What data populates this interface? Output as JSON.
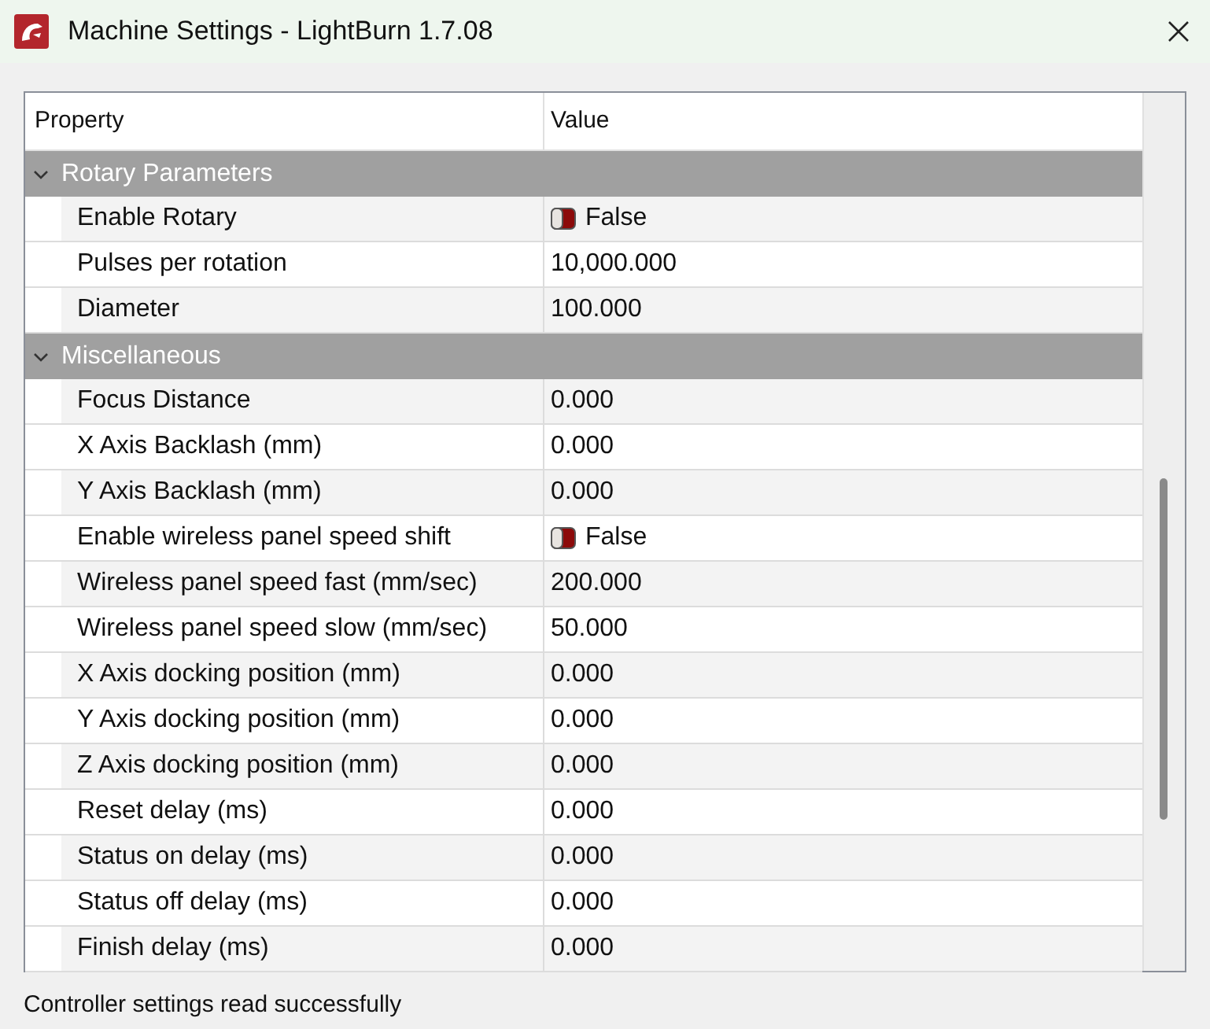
{
  "window": {
    "title": "Machine Settings - LightBurn 1.7.08"
  },
  "table": {
    "columns": [
      "Property",
      "Value"
    ],
    "groups": [
      {
        "name": "Rotary Parameters",
        "expanded": true,
        "rows": [
          {
            "property": "Enable Rotary",
            "value": "False",
            "kind": "toggle",
            "on": false
          },
          {
            "property": "Pulses per rotation",
            "value": "10,000.000",
            "kind": "number"
          },
          {
            "property": "Diameter",
            "value": "100.000",
            "kind": "number"
          }
        ]
      },
      {
        "name": "Miscellaneous",
        "expanded": true,
        "rows": [
          {
            "property": "Focus Distance",
            "value": "0.000",
            "kind": "number"
          },
          {
            "property": "X Axis Backlash (mm)",
            "value": "0.000",
            "kind": "number"
          },
          {
            "property": "Y Axis Backlash (mm)",
            "value": "0.000",
            "kind": "number"
          },
          {
            "property": "Enable wireless panel speed shift",
            "value": "False",
            "kind": "toggle",
            "on": false
          },
          {
            "property": "Wireless panel speed fast (mm/sec)",
            "value": "200.000",
            "kind": "number"
          },
          {
            "property": "Wireless panel speed slow (mm/sec)",
            "value": "50.000",
            "kind": "number"
          },
          {
            "property": "X Axis docking position (mm)",
            "value": "0.000",
            "kind": "number"
          },
          {
            "property": "Y Axis docking position (mm)",
            "value": "0.000",
            "kind": "number"
          },
          {
            "property": "Z Axis docking position (mm)",
            "value": "0.000",
            "kind": "number"
          },
          {
            "property": "Reset delay (ms)",
            "value": "0.000",
            "kind": "number"
          },
          {
            "property": "Status on delay (ms)",
            "value": "0.000",
            "kind": "number"
          },
          {
            "property": "Status off delay (ms)",
            "value": "0.000",
            "kind": "number"
          },
          {
            "property": "Finish delay (ms)",
            "value": "0.000",
            "kind": "number"
          }
        ]
      }
    ]
  },
  "status_bar": "Controller settings read successfully"
}
